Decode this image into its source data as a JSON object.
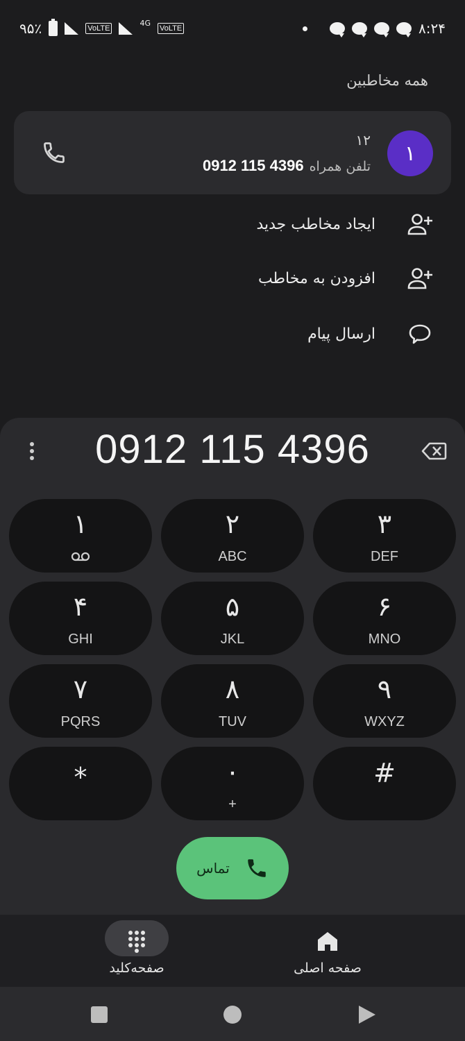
{
  "status_bar": {
    "battery_text": "۹۵٪",
    "volte_1": "VoLTE",
    "network_type": "4G",
    "volte_2": "VoLTE",
    "time": "۸:۲۴"
  },
  "all_contacts_label": "همه مخاطبین",
  "contact": {
    "avatar_initial": "۱",
    "name": "۱۲",
    "phone_type": "تلفن همراه",
    "phone_number": "0912 115 4396"
  },
  "actions": [
    {
      "label": "ایجاد مخاطب جدید",
      "icon": "add-person-icon"
    },
    {
      "label": "افزودن به مخاطب",
      "icon": "add-person-icon"
    },
    {
      "label": "ارسال پیام",
      "icon": "message-bubble-icon"
    }
  ],
  "dialer": {
    "number": "0912 115 4396",
    "keys": [
      {
        "digit": "۱",
        "letters": ""
      },
      {
        "digit": "۲",
        "letters": "ABC"
      },
      {
        "digit": "۳",
        "letters": "DEF"
      },
      {
        "digit": "۴",
        "letters": "GHI"
      },
      {
        "digit": "۵",
        "letters": "JKL"
      },
      {
        "digit": "۶",
        "letters": "MNO"
      },
      {
        "digit": "۷",
        "letters": "PQRS"
      },
      {
        "digit": "۸",
        "letters": "TUV"
      },
      {
        "digit": "۹",
        "letters": "WXYZ"
      },
      {
        "digit": "*",
        "letters": ""
      },
      {
        "digit": "۰",
        "letters": "+"
      },
      {
        "digit": "#",
        "letters": ""
      }
    ],
    "call_label": "تماس"
  },
  "bottom_nav": {
    "keypad_label": "صفحه‌کلید",
    "home_label": "صفحه اصلی"
  },
  "colors": {
    "accent_call": "#5bc37a",
    "avatar": "#5a2ec6",
    "background": "#1c1c1e"
  }
}
